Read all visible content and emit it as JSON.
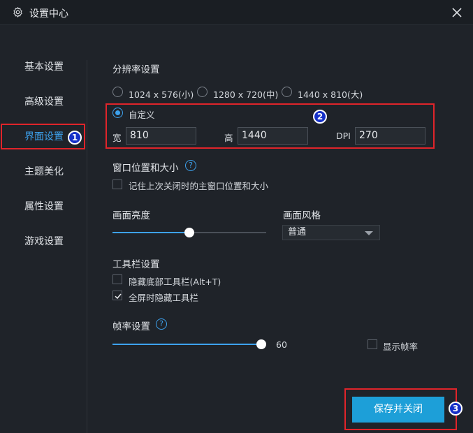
{
  "window": {
    "title": "设置中心"
  },
  "sidebar": {
    "items": [
      {
        "label": "基本设置"
      },
      {
        "label": "高级设置"
      },
      {
        "label": "界面设置"
      },
      {
        "label": "主题美化"
      },
      {
        "label": "属性设置"
      },
      {
        "label": "游戏设置"
      }
    ],
    "active_index": 2
  },
  "resolution": {
    "heading": "分辨率设置",
    "options": [
      "1024 x 576(小)",
      "1280 x 720(中)",
      "1440 x 810(大)"
    ],
    "custom_label": "自定义",
    "custom_selected": true,
    "width_label": "宽",
    "width_value": "810",
    "height_label": "高",
    "height_value": "1440",
    "dpi_label": "DPI",
    "dpi_value": "270"
  },
  "window_position": {
    "heading": "窗口位置和大小",
    "remember_label": "记住上次关闭时的主窗口位置和大小",
    "remember_checked": false
  },
  "brightness": {
    "heading": "画面亮度",
    "level_percent": 50
  },
  "style": {
    "heading": "画面风格",
    "selected": "普通"
  },
  "toolbar": {
    "heading": "工具栏设置",
    "hide_bottom_label": "隐藏底部工具栏(Alt+T)",
    "hide_bottom_checked": false,
    "fullscreen_hide_label": "全屏时隐藏工具栏",
    "fullscreen_hide_checked": true
  },
  "framerate": {
    "heading": "帧率设置",
    "value": "60",
    "show_fps_label": "显示帧率",
    "show_fps_checked": false
  },
  "save_label": "保存并关闭",
  "annotations": [
    "1",
    "2",
    "3"
  ],
  "colors": {
    "accent": "#3da2ee",
    "button": "#1d9fd8",
    "annotation": "#e0242a"
  }
}
